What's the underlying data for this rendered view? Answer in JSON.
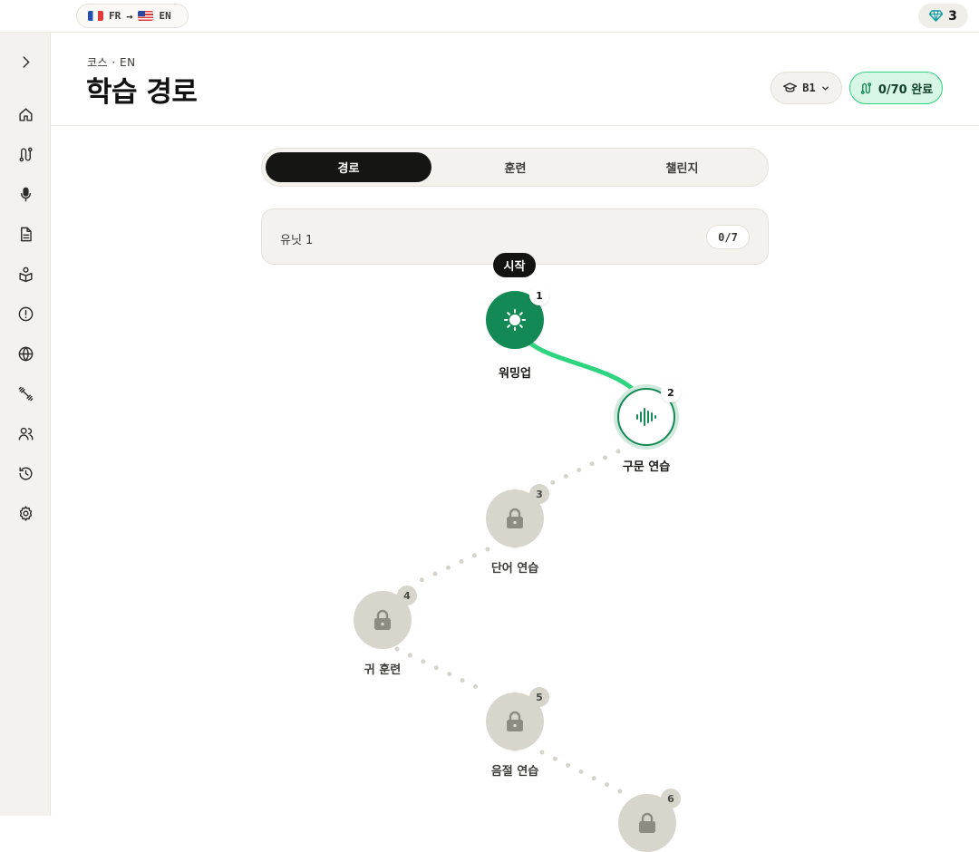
{
  "topbar": {
    "source_lang": "FR",
    "target_lang": "EN",
    "source_flag": "flag-fr-icon",
    "target_flag": "flag-us-icon",
    "gems": "3"
  },
  "sidebar": {
    "items": [
      {
        "icon": "chevron-right-icon"
      },
      {
        "icon": "home-icon"
      },
      {
        "icon": "path-icon"
      },
      {
        "icon": "microphone-icon"
      },
      {
        "icon": "document-icon"
      },
      {
        "icon": "reading-icon"
      },
      {
        "icon": "alert-icon"
      },
      {
        "icon": "globe-icon"
      },
      {
        "icon": "dumbbell-icon"
      },
      {
        "icon": "users-icon"
      },
      {
        "icon": "history-icon"
      },
      {
        "icon": "settings-icon"
      }
    ]
  },
  "header": {
    "breadcrumb": "코스 · EN",
    "title": "학습 경로",
    "level": "B1",
    "progress": "0/70 완료"
  },
  "tabs": [
    {
      "label": "경로",
      "active": true
    },
    {
      "label": "훈련",
      "active": false
    },
    {
      "label": "챌린지",
      "active": false
    }
  ],
  "unit": {
    "label": "유닛 1",
    "count": "0/7"
  },
  "path": {
    "start_label": "시작",
    "nodes": [
      {
        "number": "1",
        "label": "워밍업",
        "state": "done",
        "icon": "sun-icon"
      },
      {
        "number": "2",
        "label": "구문 연습",
        "state": "current",
        "icon": "soundwave-icon"
      },
      {
        "number": "3",
        "label": "단어 연습",
        "state": "locked",
        "icon": "lock-icon"
      },
      {
        "number": "4",
        "label": "귀 훈련",
        "state": "locked",
        "icon": "lock-icon"
      },
      {
        "number": "5",
        "label": "음절 연습",
        "state": "locked",
        "icon": "lock-icon"
      },
      {
        "number": "6",
        "label": "",
        "state": "locked",
        "icon": "lock-icon"
      }
    ]
  },
  "colors": {
    "accent_green": "#138a55",
    "accent_light": "#2ed47f",
    "locked": "#d8d5cc",
    "dark": "#131311"
  }
}
